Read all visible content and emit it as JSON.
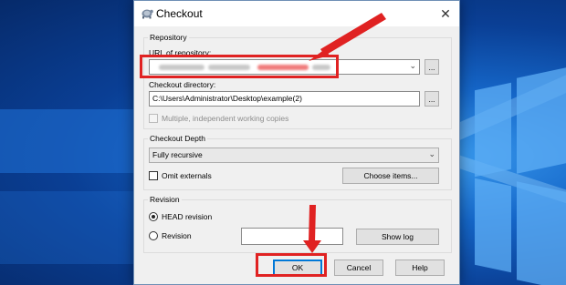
{
  "dialog": {
    "title": "Checkout",
    "close_glyph": "✕",
    "repository": {
      "group_label": "Repository",
      "url_label": "URL of repository:",
      "url_value": "",
      "browse_label": "...",
      "dir_label": "Checkout directory:",
      "dir_value": "C:\\Users\\Administrator\\Desktop\\example(2)",
      "dir_browse_label": "...",
      "multiple_label": "Multiple, independent working copies"
    },
    "depth": {
      "group_label": "Checkout Depth",
      "selected": "Fully recursive",
      "omit_label": "Omit externals",
      "choose_label": "Choose items..."
    },
    "revision": {
      "group_label": "Revision",
      "head_label": "HEAD revision",
      "rev_label": "Revision",
      "rev_value": "",
      "show_log_label": "Show log"
    },
    "buttons": {
      "ok": "OK",
      "cancel": "Cancel",
      "help": "Help"
    }
  },
  "icons": {
    "title": "tortoisesvn-icon",
    "close": "close-icon",
    "dropdown": "chevron-down-icon"
  },
  "colors": {
    "annotation": "#e02222",
    "default_button_border": "#0078d7"
  }
}
